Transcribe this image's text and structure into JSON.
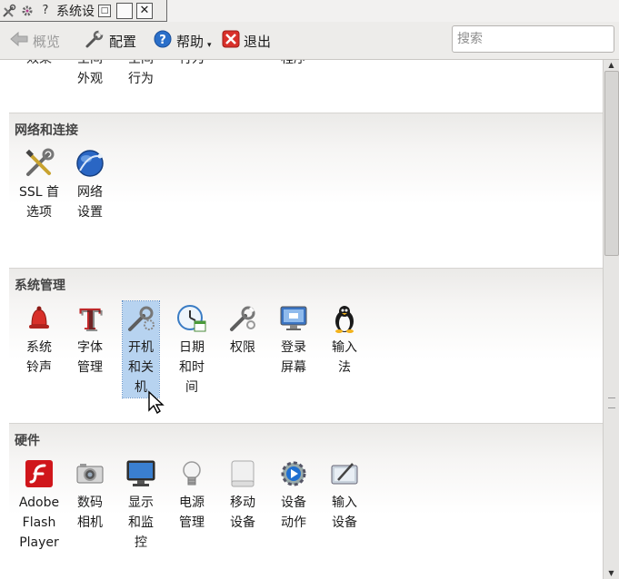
{
  "window": {
    "title": "系统设",
    "title_prefix_icons": [
      "tools-icon",
      "gear-icon"
    ],
    "help_glyph": "?",
    "restore_glyph": "□",
    "close_glyph": "✕"
  },
  "toolbar": {
    "back_label": "概览",
    "configure_label": "配置",
    "help_label": "帮助",
    "help_dropdown_glyph": "▾",
    "quit_label": "退出",
    "search_placeholder": "搜索"
  },
  "top_partial": [
    {
      "label": "效果",
      "icon": "effects-icon"
    },
    {
      "label": "空间\n外观",
      "icon": "workspace-appearance-icon"
    },
    {
      "label": "空间\n行为",
      "icon": "workspace-behavior-icon"
    },
    {
      "label": "行为",
      "icon": "window-behavior-icon"
    },
    {
      "label": "程序",
      "icon": "default-applications-icon"
    }
  ],
  "sections": [
    {
      "title": "网络和连接",
      "items": [
        {
          "label": "SSL 首\n选项",
          "icon": "ssl-tools-icon"
        },
        {
          "label": "网络\n设置",
          "icon": "network-globe-icon"
        }
      ]
    },
    {
      "title": "系统管理",
      "items": [
        {
          "label": "系统\n铃声",
          "icon": "bell-icon"
        },
        {
          "label": "字体\n管理",
          "icon": "font-icon"
        },
        {
          "label": "开机\n和关\n机",
          "icon": "startup-shutdown-icon",
          "selected": true
        },
        {
          "label": "日期\n和时\n间",
          "icon": "clock-calendar-icon"
        },
        {
          "label": "权限",
          "icon": "permissions-wrench-icon"
        },
        {
          "label": "登录\n屏幕",
          "icon": "login-screen-icon"
        },
        {
          "label": "输入\n法",
          "icon": "tux-penguin-icon"
        }
      ]
    },
    {
      "title": "硬件",
      "items": [
        {
          "label": "Adobe\nFlash\nPlayer",
          "icon": "flash-icon"
        },
        {
          "label": "数码\n相机",
          "icon": "camera-icon"
        },
        {
          "label": "显示\n和监\n控",
          "icon": "monitor-icon"
        },
        {
          "label": "电源\n管理",
          "icon": "lightbulb-icon"
        },
        {
          "label": "移动\n设备",
          "icon": "removable-drive-icon"
        },
        {
          "label": "设备\n动作",
          "icon": "device-actions-icon"
        },
        {
          "label": "输入\n设备",
          "icon": "input-tablet-icon"
        }
      ]
    }
  ],
  "scrollbar": {
    "up_glyph": "▲",
    "down_glyph": "▼",
    "position_fraction": 0.0
  }
}
